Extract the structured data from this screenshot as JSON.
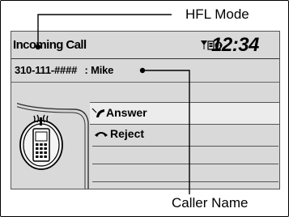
{
  "screen": {
    "title": "Incoming Call",
    "status_icons": "▼ᵢ▥◉",
    "clock": "12:34",
    "caller_number": "310-111-####",
    "caller_name_text": ": Mike"
  },
  "menu": {
    "items": [
      {
        "label": "Answer",
        "icon": "phone-answer-icon"
      },
      {
        "label": "Reject",
        "icon": "phone-reject-icon"
      }
    ]
  },
  "callouts": {
    "hfl_mode": "HFL Mode",
    "caller_name": "Caller Name"
  }
}
